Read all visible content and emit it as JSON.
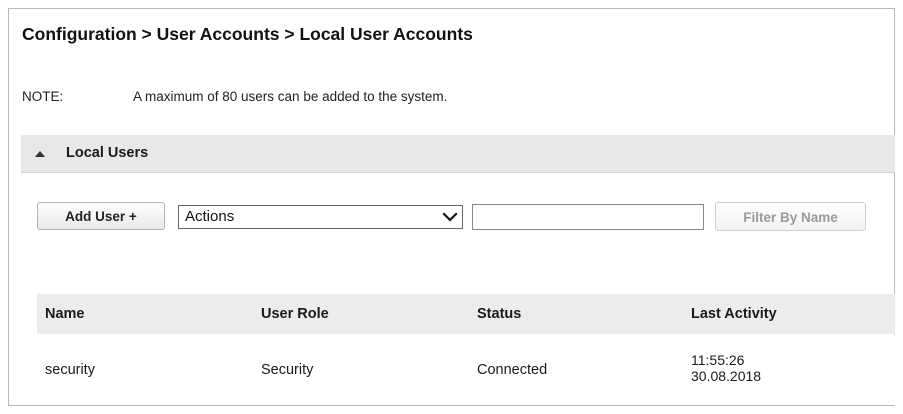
{
  "breadcrumb": {
    "text": "Configuration > User Accounts > Local User Accounts"
  },
  "note": {
    "label": "NOTE:",
    "text": "A maximum of 80 users can be added to the system."
  },
  "section": {
    "title": "Local Users",
    "toggle_icon": "collapse-triangle-icon"
  },
  "toolbar": {
    "add_user_label": "Add User +",
    "actions_select": {
      "selected": "Actions",
      "icon": "chevron-down-icon"
    },
    "filter_input": {
      "value": "",
      "placeholder": ""
    },
    "filter_button_label": "Filter By Name"
  },
  "table": {
    "columns": [
      "Name",
      "User Role",
      "Status",
      "Last Activity"
    ],
    "rows": [
      {
        "name": "security",
        "user_role": "Security",
        "status": "Connected",
        "last_activity_time": "11:55:26",
        "last_activity_date": "30.08.2018"
      }
    ]
  },
  "colors": {
    "section_header_bg": "#e8e8e8",
    "table_header_bg": "#ececec",
    "disabled_text": "#9a9a9a"
  }
}
